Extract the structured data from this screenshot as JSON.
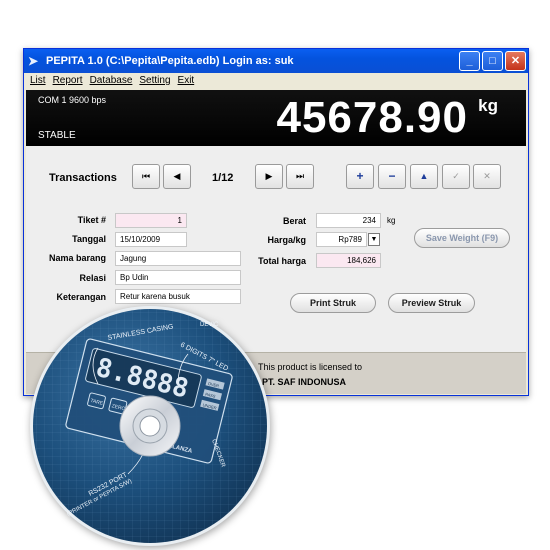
{
  "window": {
    "title": "PEPITA 1.0   (C:\\Pepita\\Pepita.edb)  Login as: suk",
    "app_icon": "app-bird-icon"
  },
  "menu": [
    "List",
    "Report",
    "Database",
    "Setting",
    "Exit"
  ],
  "scale": {
    "port": "COM 1   9600 bps",
    "status": "STABLE",
    "weight": "45678.90",
    "unit": "kg"
  },
  "transactions": {
    "label": "Transactions",
    "counter": "1/12",
    "nav_icons": [
      "first-icon",
      "prev-icon",
      "next-icon",
      "last-icon"
    ],
    "edit_icons": [
      "add-icon",
      "remove-icon",
      "up-icon",
      "confirm-icon",
      "cancel-icon"
    ],
    "edit_symbols": [
      "+",
      "−",
      "▲",
      "✓",
      "✕"
    ]
  },
  "form": {
    "tiket_label": "Tiket #",
    "tiket_value": "1",
    "tanggal_label": "Tanggal",
    "tanggal_value": "15/10/2009",
    "nama_label": "Nama barang",
    "nama_value": "Jagung",
    "relasi_label": "Relasi",
    "relasi_value": "Bp Udin",
    "keterangan_label": "Keterangan",
    "keterangan_value": "Retur karena busuk",
    "berat_label": "Berat",
    "berat_value": "234",
    "berat_unit": "kg",
    "harga_label": "Harga/kg",
    "harga_value": "Rp789",
    "total_label": "Total harga",
    "total_value": "184,626"
  },
  "buttons": {
    "save_weight": "Save Weight (F9)",
    "print": "Print Struk",
    "preview": "Preview Struk"
  },
  "status": {
    "license_line1": "This product is licensed to",
    "license_line2": "PT. SAF INDONUSA"
  },
  "cd": {
    "labels": [
      "STAINLESS CASING",
      "6 DIGITS 7\" LED",
      "CHECKER",
      "RS232 PORT",
      "(PRINTER or PEPITA S/W)",
      "DEVIC",
      "BALANZA",
      "TARE",
      "ZERO",
      "OVER",
      "PASS",
      "UNDER"
    ],
    "digits": "8.8888"
  },
  "colors": {
    "titlebar": "#0a5ff1",
    "scale_bg": "#000000",
    "pink_field": "#fbe8f1",
    "cd_blue": "#1c4f7c"
  }
}
